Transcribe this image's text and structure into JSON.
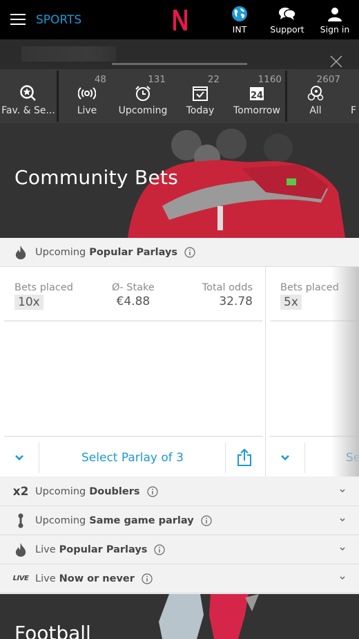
{
  "header": {
    "brand": "SPORTS",
    "logo": "N",
    "actions": [
      {
        "label": "INT",
        "icon": "globe-icon"
      },
      {
        "label": "Support",
        "icon": "chat-bubbles-icon"
      },
      {
        "label": "Sign in",
        "icon": "user-icon"
      }
    ]
  },
  "nav": {
    "items": [
      {
        "label": "Fav. & Se...",
        "count": "",
        "icon": "star-search-icon"
      },
      {
        "label": "Live",
        "count": "48",
        "icon": "live-broadcast-icon"
      },
      {
        "label": "Upcoming",
        "count": "131",
        "icon": "alarm-clock-icon"
      },
      {
        "label": "Today",
        "count": "22",
        "icon": "calendar-check-icon"
      },
      {
        "label": "Tomorrow",
        "count": "1160",
        "icon": "calendar-24-icon"
      },
      {
        "label": "All",
        "count": "2607",
        "icon": "sports-balls-icon"
      },
      {
        "label": "F",
        "count": "",
        "icon": ""
      }
    ]
  },
  "hero": {
    "title": "Community Bets"
  },
  "popular": {
    "prefix": "Upcoming",
    "title": "Popular Parlays",
    "cards": [
      {
        "bets_label": "Bets placed",
        "bets_value": "10x",
        "stake_label": "Ø- Stake",
        "stake_value": "€4.88",
        "odds_label": "Total odds",
        "odds_value": "32.78",
        "select_label": "Select Parlay of 3"
      },
      {
        "bets_label": "Bets placed",
        "bets_value": "5x",
        "select_label": "Se"
      }
    ]
  },
  "accordions": [
    {
      "icon": "x2",
      "prefix": "Upcoming",
      "title": "Doublers"
    },
    {
      "icon": "same-game-icon",
      "prefix": "Upcoming",
      "title": "Same game parlay"
    },
    {
      "icon": "flame-icon",
      "prefix": "Live",
      "title": "Popular Parlays"
    },
    {
      "icon": "LIVE",
      "prefix": "Live",
      "title": "Now or never"
    }
  ],
  "hero2": {
    "title": "Football"
  },
  "colors": {
    "accent": "#1a9ad6",
    "brand_red": "#e8174a"
  }
}
